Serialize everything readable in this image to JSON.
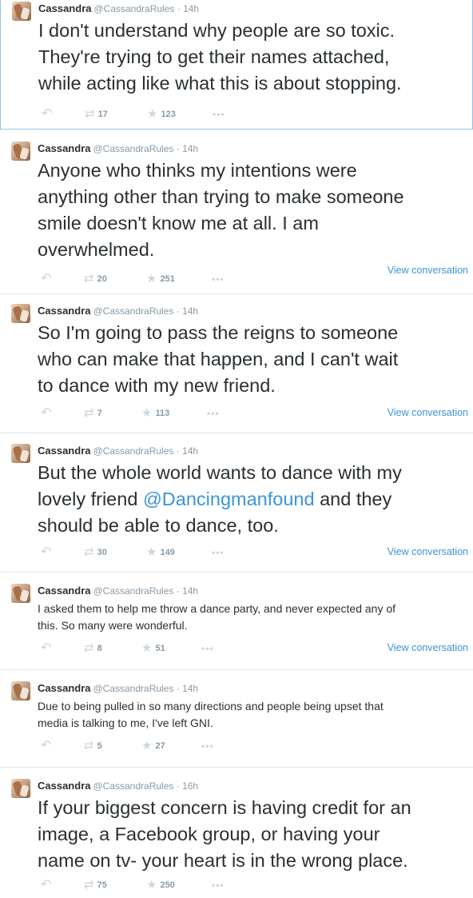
{
  "tweets": [
    {
      "name": "Cassandra",
      "handle": "@CassandraRules",
      "time": "14h",
      "size": "big",
      "text_before": "I don't understand why people are so toxic.\nThey're trying to get their names attached,\nwhile acting like what this is about stopping.",
      "mention": "",
      "text_after": "",
      "retweets": "17",
      "favorites": "123",
      "view_conversation": ""
    },
    {
      "name": "Cassandra",
      "handle": "@CassandraRules",
      "time": "14h",
      "size": "big",
      "text_before": "Anyone who thinks my intentions were\nanything other than trying to make someone\nsmile doesn't know me at all. I am\noverwhelmed.",
      "mention": "",
      "text_after": "",
      "retweets": "20",
      "favorites": "251",
      "view_conversation": "View conversation"
    },
    {
      "name": "Cassandra",
      "handle": "@CassandraRules",
      "time": "14h",
      "size": "big",
      "text_before": "So I'm going to pass the reigns to someone\nwho can make that happen, and I can't wait\nto dance with my new friend.",
      "mention": "",
      "text_after": "",
      "retweets": "7",
      "favorites": "113",
      "view_conversation": "View conversation"
    },
    {
      "name": "Cassandra",
      "handle": "@CassandraRules",
      "time": "14h",
      "size": "big",
      "text_before": "But the whole world wants to dance with my\nlovely friend ",
      "mention": "@Dancingmanfound",
      "text_after": " and they\nshould be able to dance, too.",
      "retweets": "30",
      "favorites": "149",
      "view_conversation": "View conversation"
    },
    {
      "name": "Cassandra",
      "handle": "@CassandraRules",
      "time": "14h",
      "size": "small",
      "text_before": "I asked them to help me throw a dance party, and never expected any of\nthis. So many were wonderful.",
      "mention": "",
      "text_after": "",
      "retweets": "8",
      "favorites": "51",
      "view_conversation": "View conversation"
    },
    {
      "name": "Cassandra",
      "handle": "@CassandraRules",
      "time": "14h",
      "size": "small",
      "text_before": "Due to being pulled in so many directions and people being upset that\nmedia is talking to me, I've left GNI.",
      "mention": "",
      "text_after": "",
      "retweets": "5",
      "favorites": "27",
      "view_conversation": ""
    },
    {
      "name": "Cassandra",
      "handle": "@CassandraRules",
      "time": "16h",
      "size": "big",
      "text_before": "If your biggest concern is having credit for an\nimage, a Facebook group, or having your\nname on tv- your heart is in the wrong place.",
      "mention": "",
      "text_after": "",
      "retweets": "75",
      "favorites": "250",
      "view_conversation": ""
    }
  ],
  "icons": {
    "reply": "reply-icon",
    "retweet": "retweet-icon",
    "favorite": "star-icon",
    "more": "more-icon"
  },
  "colors": {
    "link": "#3b94d9",
    "text": "#292f33",
    "muted": "#8899a6",
    "icon": "#ccd6dd"
  }
}
